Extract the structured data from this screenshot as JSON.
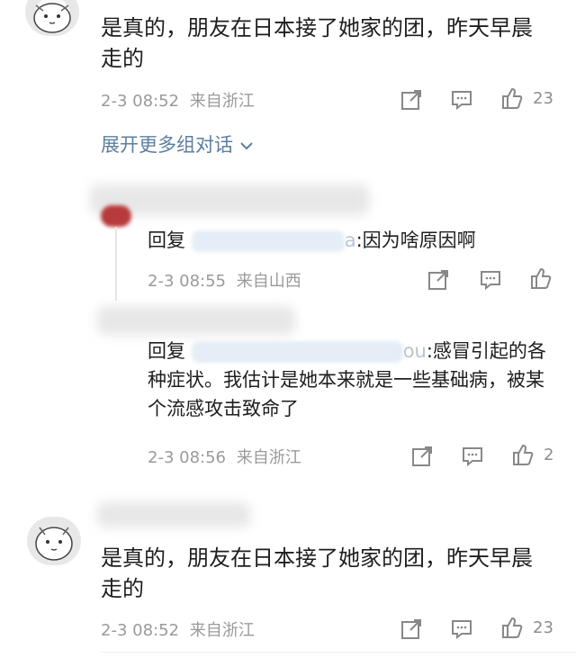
{
  "comments": [
    {
      "text": "是真的，朋友在日本接了她家的团，昨天早晨走的",
      "time": "2-3 08:52",
      "location": "来自浙江",
      "likes": "23"
    },
    {
      "text": "是真的，朋友在日本接了她家的团，昨天早晨走的",
      "time": "2-3 08:52",
      "location": "来自浙江",
      "likes": "23"
    }
  ],
  "expand_label": "展开更多组对话",
  "replies": [
    {
      "prefix": "回复",
      "mention_tail": "a",
      "text": ":因为啥原因啊",
      "time": "2-3 08:55",
      "location": "来自山西",
      "likes": ""
    },
    {
      "prefix": "回复",
      "mention_tail": "ou",
      "text": ":感冒引起的各种症状。我估计是她本来就是一些基础病，被某个流感攻击致命了",
      "time": "2-3 08:56",
      "location": "来自浙江",
      "likes": "2"
    }
  ],
  "icons": {
    "share": "share-icon",
    "comment": "comment-icon",
    "like": "thumbs-up-icon",
    "expand": "chevron-down-icon"
  },
  "colors": {
    "link": "#5b7fa0",
    "meta": "#9a9a9a"
  }
}
